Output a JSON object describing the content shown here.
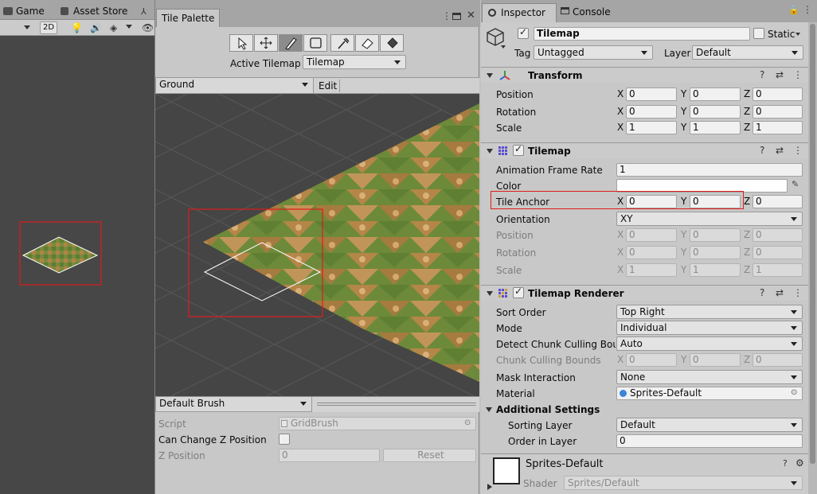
{
  "scene": {
    "tabs": [
      {
        "label": "Game",
        "icon": "gamepad-icon"
      },
      {
        "label": "Asset Store",
        "icon": "store-icon"
      }
    ],
    "toolbar": {
      "mode_2d": "2D"
    }
  },
  "tile_palette": {
    "tab_title": "Tile Palette",
    "tools": [
      "select-tool-icon",
      "move-tool-icon",
      "paint-brush-icon",
      "box-fill-icon",
      "picker-icon",
      "eraser-icon",
      "fill-bucket-icon"
    ],
    "active_tool_index": 2,
    "active_tilemap_label": "Active Tilemap",
    "active_tilemap_value": "Tilemap",
    "palette_value": "Ground",
    "edit_label": "Edit",
    "brush_value": "Default Brush",
    "script_label": "Script",
    "script_value": "GridBrush",
    "can_change_z_label": "Can Change Z Position",
    "z_position_label": "Z Position",
    "z_position_value": "0",
    "reset_label": "Reset"
  },
  "inspector": {
    "tabs": [
      {
        "label": "Inspector"
      },
      {
        "label": "Console"
      }
    ],
    "object_name": "Tilemap",
    "static_label": "Static",
    "tag_label": "Tag",
    "tag_value": "Untagged",
    "layer_label": "Layer",
    "layer_value": "Default",
    "transform": {
      "title": "Transform",
      "rows": [
        {
          "label": "Position",
          "x": "0",
          "y": "0",
          "z": "0"
        },
        {
          "label": "Rotation",
          "x": "0",
          "y": "0",
          "z": "0"
        },
        {
          "label": "Scale",
          "x": "1",
          "y": "1",
          "z": "1"
        }
      ]
    },
    "tilemap": {
      "title": "Tilemap",
      "animation_frame_rate_label": "Animation Frame Rate",
      "animation_frame_rate_value": "1",
      "color_label": "Color",
      "tile_anchor_label": "Tile Anchor",
      "tile_anchor": {
        "x": "0",
        "y": "0",
        "z": "0"
      },
      "orientation_label": "Orientation",
      "orientation_value": "XY",
      "disabled_rows": [
        {
          "label": "Position",
          "x": "0",
          "y": "0",
          "z": "0"
        },
        {
          "label": "Rotation",
          "x": "0",
          "y": "0",
          "z": "0"
        },
        {
          "label": "Scale",
          "x": "1",
          "y": "1",
          "z": "1"
        }
      ]
    },
    "renderer": {
      "title": "Tilemap Renderer",
      "sort_order_label": "Sort Order",
      "sort_order_value": "Top Right",
      "mode_label": "Mode",
      "mode_value": "Individual",
      "detect_chunk_label": "Detect Chunk Culling Bour",
      "detect_chunk_value": "Auto",
      "chunk_bounds_label": "Chunk Culling Bounds",
      "chunk_bounds": {
        "x": "0",
        "y": "0",
        "z": "0"
      },
      "mask_interaction_label": "Mask Interaction",
      "mask_interaction_value": "None",
      "material_label": "Material",
      "material_value": "Sprites-Default",
      "additional_settings_label": "Additional Settings",
      "sorting_layer_label": "Sorting Layer",
      "sorting_layer_value": "Default",
      "order_in_layer_label": "Order in Layer",
      "order_in_layer_value": "0"
    },
    "material_asset": {
      "name": "Sprites-Default",
      "shader_label": "Shader",
      "shader_value": "Sprites/Default"
    },
    "axis_labels": {
      "x": "X",
      "y": "Y",
      "z": "Z"
    }
  },
  "colors": {
    "highlight": "#e01b1b",
    "grass": "#6c8a3c",
    "dirt": "#b98a4a",
    "background_dark": "#474747"
  }
}
